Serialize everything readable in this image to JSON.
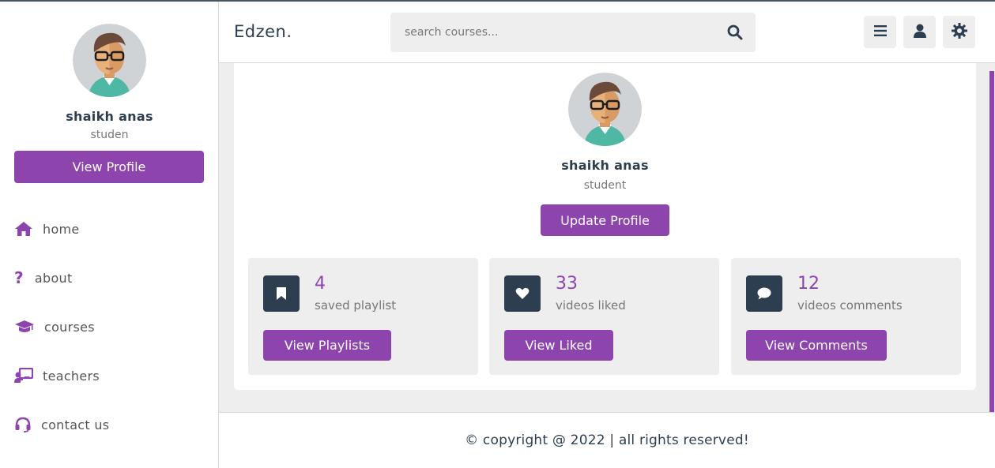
{
  "header": {
    "logo": "Edzen.",
    "search_placeholder": "search courses...",
    "buttons": [
      "menu-icon",
      "user-icon",
      "settings-icon"
    ]
  },
  "sidebar": {
    "profile": {
      "name": "shaikh anas",
      "role": "studen",
      "button": "View Profile"
    },
    "nav": [
      {
        "label": "home",
        "icon": "home-icon"
      },
      {
        "label": "about",
        "icon": "question-icon"
      },
      {
        "label": "courses",
        "icon": "graduation-cap-icon"
      },
      {
        "label": "teachers",
        "icon": "chalkboard-teacher-icon"
      },
      {
        "label": "contact us",
        "icon": "headset-icon"
      }
    ]
  },
  "profile": {
    "name": "shaikh anas",
    "role": "student",
    "update_button": "Update Profile",
    "stats": [
      {
        "count": "4",
        "label": "saved playlist",
        "button": "View Playlists",
        "icon": "bookmark-icon"
      },
      {
        "count": "33",
        "label": "videos liked",
        "button": "View Liked",
        "icon": "heart-icon"
      },
      {
        "count": "12",
        "label": "videos comments",
        "button": "View Comments",
        "icon": "comment-icon"
      }
    ]
  },
  "footer": {
    "text": "© copyright @ 2022 | all rights reserved!"
  },
  "colors": {
    "accent": "#8e44ad",
    "dark": "#2c3e50",
    "background": "#eeeeee"
  }
}
